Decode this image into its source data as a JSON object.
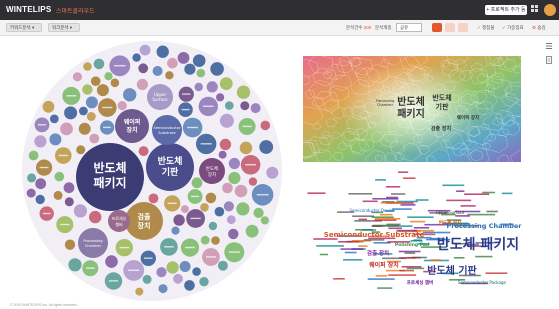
{
  "app": {
    "brand": "WINTELIPS",
    "subtitle": "스마트클라우드",
    "cta_label": "+ 프로젝트 추가 등록"
  },
  "toolbar": {
    "select_1": "키워드분석 ▾",
    "select_2": "워크분석 ▾",
    "count_label": "분석건수",
    "count_value": "500",
    "sort_label": "분석계층",
    "sort_value": "공유",
    "opt_1": "쟁점물",
    "opt_2": "가중점표",
    "opt_3": "숨김"
  },
  "colors": {
    "accent": "#e0582c",
    "bar": "#2f2f33",
    "main_bubble": "#3b3c73"
  },
  "bubble_chart": {
    "labels": [
      {
        "text": "반도체 패키지",
        "size": "xl"
      },
      {
        "text": "반도체 기판",
        "size": "l"
      },
      {
        "text": "검출 장치",
        "size": "m"
      },
      {
        "text": "웨이퍼 장치",
        "size": "m"
      },
      {
        "text": "Semiconductor Substrate",
        "size": "s"
      },
      {
        "text": "Upper Surface",
        "size": "s"
      },
      {
        "text": "반도체 장치",
        "size": "s"
      },
      {
        "text": "프로세싱 챔버",
        "size": "s"
      },
      {
        "text": "Processing Chamber",
        "size": "s"
      }
    ]
  },
  "voronoi_chart": {
    "labels": [
      "반도체 패키지",
      "반도체 기판",
      "Processing Chamber",
      "검출 장치",
      "웨이퍼 장치"
    ]
  },
  "word_cloud": {
    "words": [
      {
        "text": "반도체 패키지",
        "size": 14,
        "color": "#2d3a8c"
      },
      {
        "text": "Semiconductor Substrate",
        "size": 7,
        "color": "#d9531e"
      },
      {
        "text": "반도체 기판",
        "size": 10,
        "color": "#2d3a8c"
      },
      {
        "text": "Processing Chamber",
        "size": 6.5,
        "color": "#2d6bb5"
      },
      {
        "text": "웨이퍼 장치",
        "size": 6,
        "color": "#c62828"
      },
      {
        "text": "검출 장치",
        "size": 5.5,
        "color": "#7b1fa2"
      },
      {
        "text": "Polishing Pad",
        "size": 4.5,
        "color": "#388e3c"
      },
      {
        "text": "Upper Surface",
        "size": 4,
        "color": "#333333"
      },
      {
        "text": "반도체 장치",
        "size": 4.5,
        "color": "#e65100"
      },
      {
        "text": "Semiconductor Device",
        "size": 4,
        "color": "#1565c0"
      },
      {
        "text": "프로세싱 챔버",
        "size": 4.5,
        "color": "#6a1b9a"
      },
      {
        "text": "Semiconductor Package",
        "size": 4,
        "color": "#00695c"
      }
    ]
  },
  "footer": {
    "text": "© 2019 WINTELIPS Inc. All rights reserved."
  }
}
